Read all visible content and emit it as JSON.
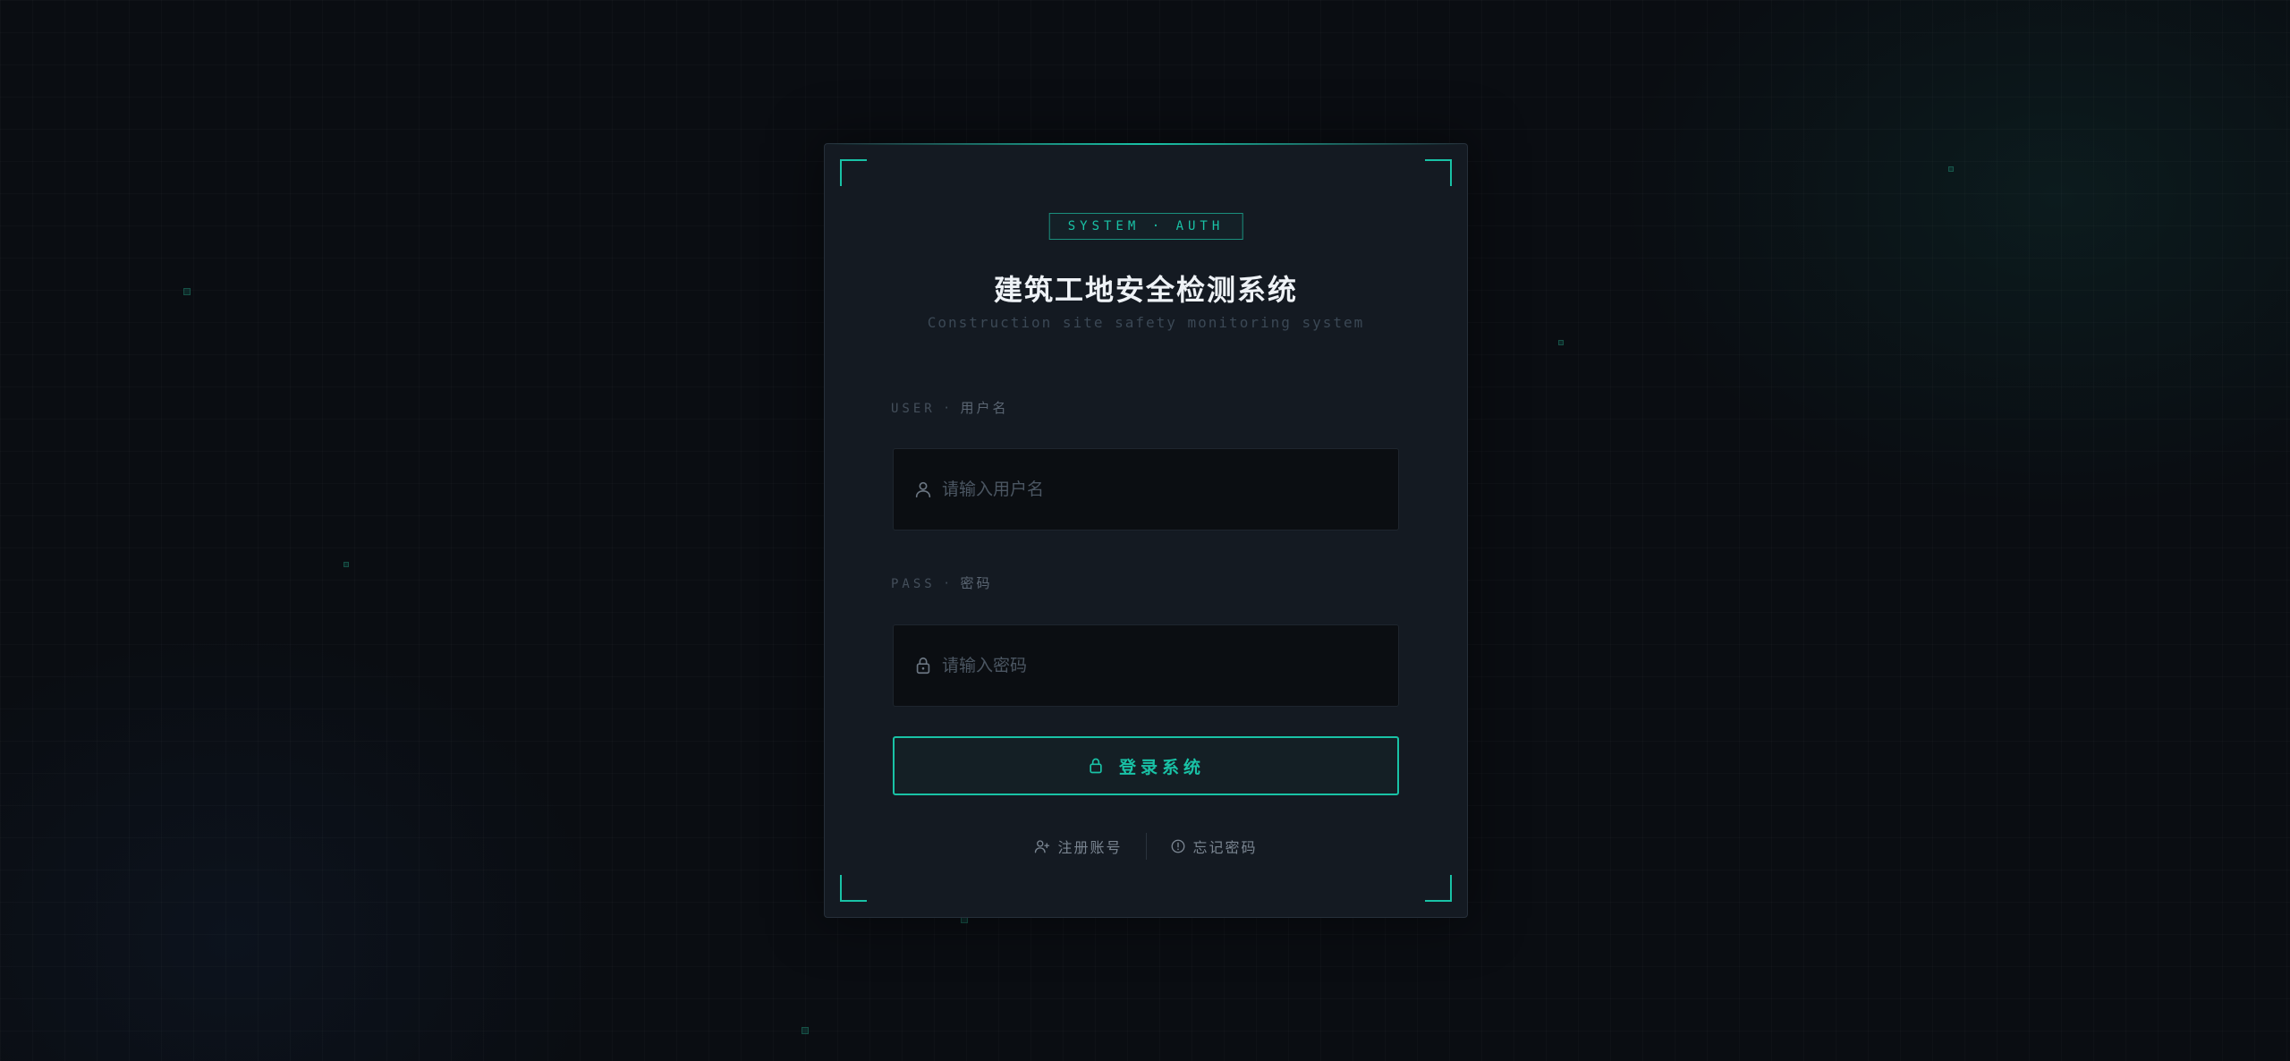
{
  "auth_badge": "SYSTEM · AUTH",
  "title": "建筑工地安全检测系统",
  "subtitle": "Construction site safety monitoring system",
  "username": {
    "label_en": "USER",
    "separator": "·",
    "label_cn": "用户名",
    "placeholder": "请输入用户名",
    "value": "",
    "icon": "user-icon"
  },
  "password": {
    "label_en": "PASS",
    "separator": "·",
    "label_cn": "密码",
    "placeholder": "请输入密码",
    "value": "",
    "icon": "lock-icon"
  },
  "login_button": {
    "label": "登录系统",
    "icon": "lock-icon"
  },
  "links": {
    "register": {
      "label": "注册账号",
      "icon": "user-plus-icon"
    },
    "forgot": {
      "label": "忘记密码",
      "icon": "info-circle-icon"
    }
  },
  "colors": {
    "accent": "#19c2a6",
    "background": "#0a0d12",
    "card": "#141a22",
    "input": "#0b0e12"
  }
}
